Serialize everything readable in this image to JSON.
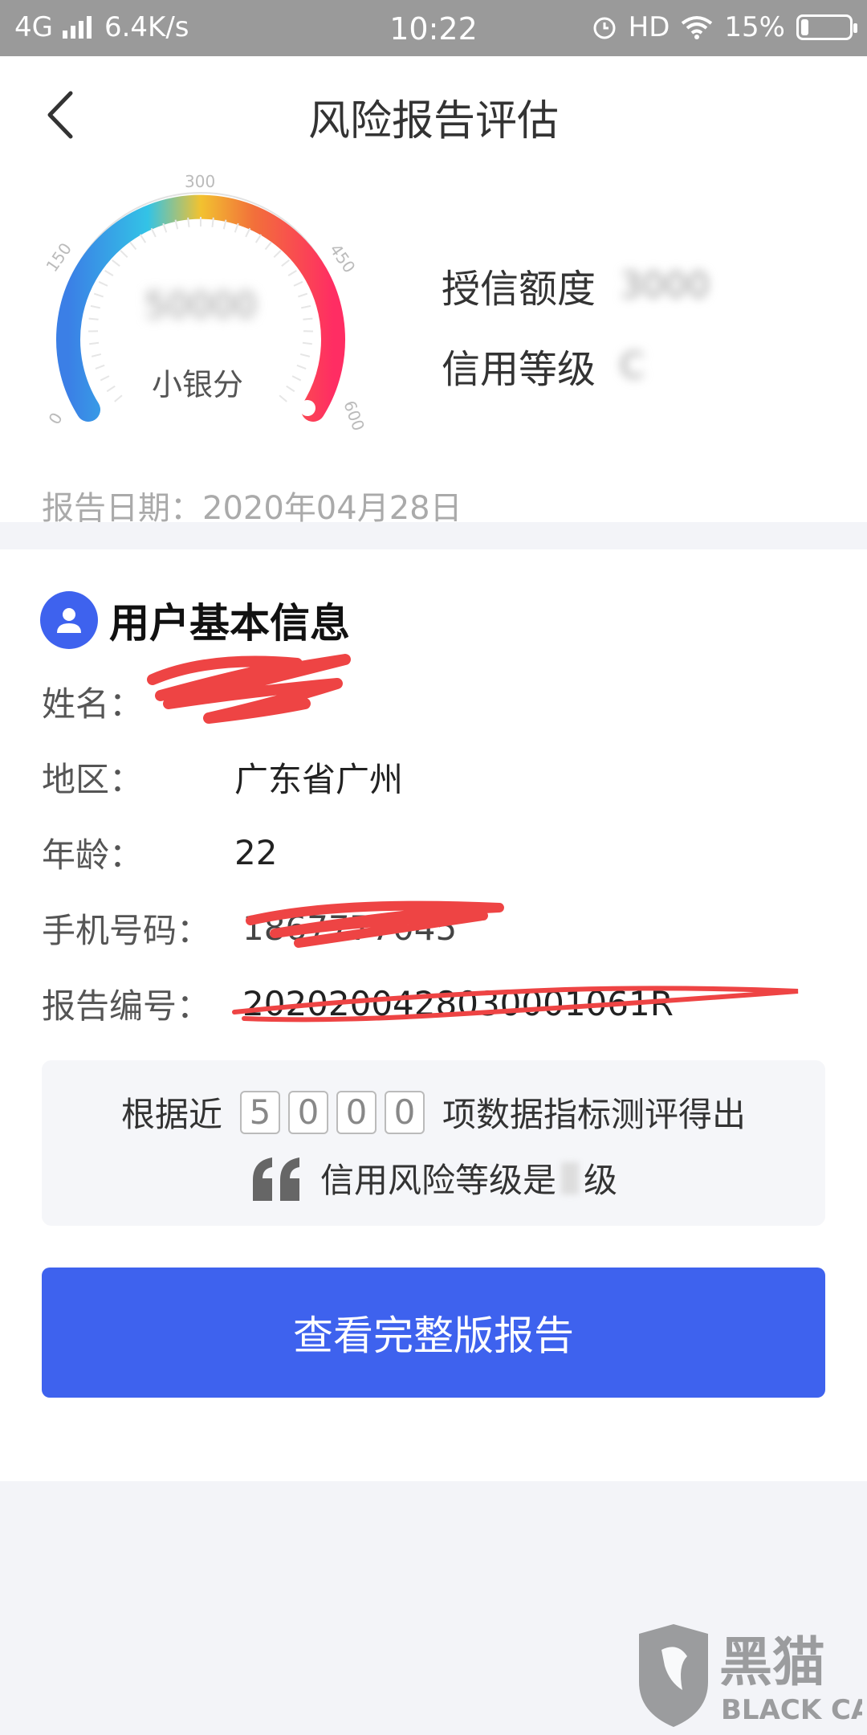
{
  "status_bar": {
    "network": "4G",
    "speed": "6.4K/s",
    "time": "10:22",
    "hd": "HD",
    "battery_pct": "15%",
    "battery_level": 0.15
  },
  "header": {
    "title": "风险报告评估"
  },
  "gauge": {
    "ticks": [
      "0",
      "150",
      "300",
      "450",
      "600"
    ],
    "score_blurred": "50000",
    "label": "小银分"
  },
  "credit": {
    "limit_label": "授信额度",
    "limit_value": "3000",
    "grade_label": "信用等级",
    "grade_value": "C"
  },
  "report_date": "报告日期：2020年04月28日",
  "user_info": {
    "section_title": "用户基本信息",
    "rows": [
      {
        "label": "姓名：",
        "value": ""
      },
      {
        "label": "地区：",
        "value": "广东省广州"
      },
      {
        "label": "年龄：",
        "value": "22"
      },
      {
        "label": "手机号码：",
        "value": "1867777045"
      },
      {
        "label": "报告编号：",
        "value": "2020200428030001061R"
      }
    ]
  },
  "evaluation": {
    "prefix": "根据近",
    "digits": [
      "5",
      "0",
      "0",
      "0"
    ],
    "suffix": "项数据指标测评得出",
    "line2_prefix": "信用风险等级是",
    "line2_suffix": "级"
  },
  "cta_label": "查看完整版报告",
  "watermark": {
    "text_cn": "黑猫",
    "text_en": "BLACK CAT"
  }
}
